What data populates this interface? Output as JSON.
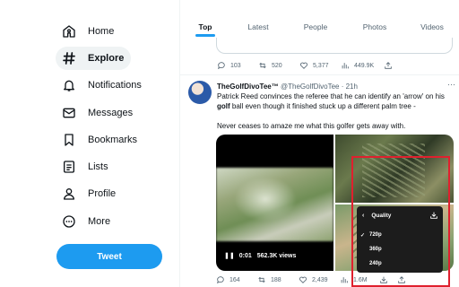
{
  "sidebar": {
    "items": [
      {
        "label": "Home",
        "icon": "home-icon"
      },
      {
        "label": "Explore",
        "icon": "hashtag-icon"
      },
      {
        "label": "Notifications",
        "icon": "bell-icon"
      },
      {
        "label": "Messages",
        "icon": "envelope-icon"
      },
      {
        "label": "Bookmarks",
        "icon": "bookmark-icon"
      },
      {
        "label": "Lists",
        "icon": "list-icon"
      },
      {
        "label": "Profile",
        "icon": "person-icon"
      },
      {
        "label": "More",
        "icon": "more-circle-icon"
      }
    ],
    "active_index": 1,
    "tweet_button": "Tweet"
  },
  "tabs": [
    {
      "label": "Top"
    },
    {
      "label": "Latest"
    },
    {
      "label": "People"
    },
    {
      "label": "Photos"
    },
    {
      "label": "Videos"
    }
  ],
  "prev_tweet": {
    "replies": "103",
    "retweets": "520",
    "likes": "5,377",
    "views": "449.9K"
  },
  "tweet": {
    "name": "TheGolfDivoTee™",
    "handle": "@TheGolfDivoTee",
    "time": "· 21h",
    "more": "···",
    "text1_a": "Patrick Reed convinces the referee that he can identify an 'arrow' on his",
    "text1_b": "golf",
    "text1_c": " ball even though it finished stuck up a different palm tree -",
    "text2": "Never ceases to amaze me what this golfer gets away with.",
    "video_time": "0:01",
    "video_views": "562.3K views",
    "replies": "164",
    "retweets": "188",
    "likes": "2,439",
    "views": "1.6M"
  },
  "quality_menu": {
    "title": "Quality",
    "options": [
      "720p",
      "360p",
      "240p"
    ],
    "selected": "720p"
  },
  "colors": {
    "accent": "#1d9bf0",
    "highlight_box": "#e0202e",
    "menu_bg": "#1c1c1c"
  }
}
